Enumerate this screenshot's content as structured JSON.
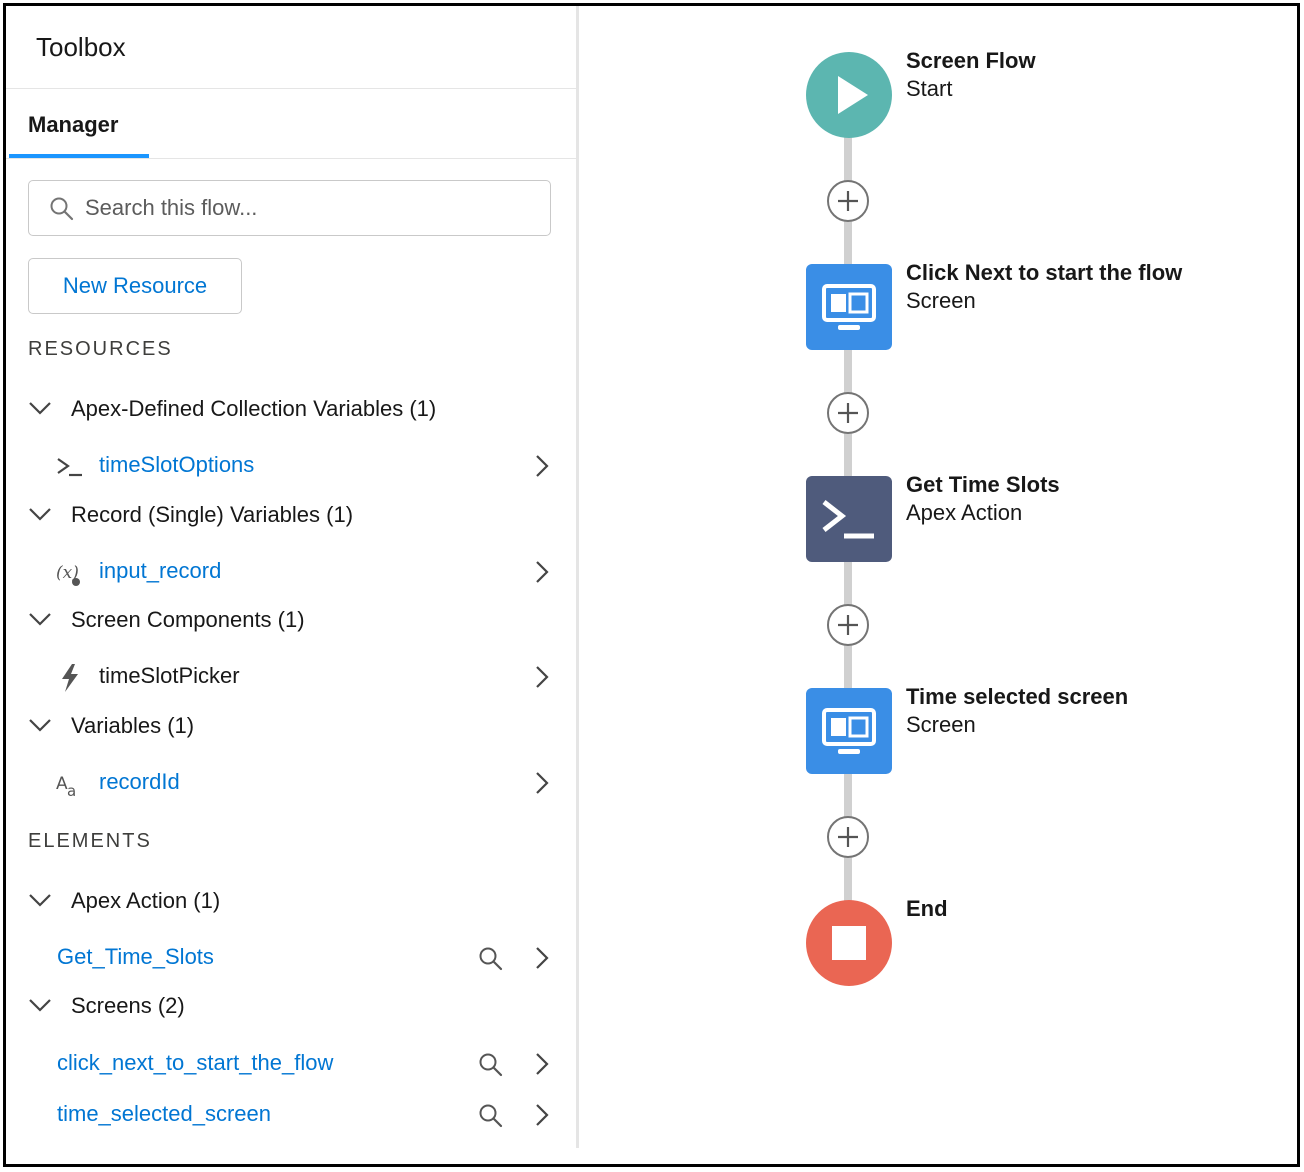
{
  "toolbox": {
    "title": "Toolbox",
    "tab": "Manager",
    "search_placeholder": "Search this flow...",
    "new_resource_label": "New Resource",
    "resources_label": "RESOURCES",
    "elements_label": "ELEMENTS",
    "resource_groups": [
      {
        "label": "Apex-Defined Collection Variables (1)",
        "items": [
          {
            "label": "timeSlotOptions",
            "icon": "apex-terminal-icon"
          }
        ]
      },
      {
        "label": "Record (Single) Variables (1)",
        "items": [
          {
            "label": "input_record",
            "icon": "record-variable-icon"
          }
        ]
      },
      {
        "label": "Screen Components (1)",
        "items": [
          {
            "label": "timeSlotPicker",
            "icon": "lightning-bolt-icon"
          }
        ]
      },
      {
        "label": "Variables (1)",
        "items": [
          {
            "label": "recordId",
            "icon": "text-variable-icon"
          }
        ]
      }
    ],
    "element_groups": [
      {
        "label": "Apex Action (1)",
        "items": [
          {
            "label": "Get_Time_Slots"
          }
        ]
      },
      {
        "label": "Screens (2)",
        "items": [
          {
            "label": "click_next_to_start_the_flow"
          },
          {
            "label": "time_selected_screen"
          }
        ]
      }
    ]
  },
  "canvas": {
    "nodes": [
      {
        "title": "Screen Flow",
        "subtitle": "Start",
        "color": "#5cb6b0",
        "icon": "play-icon"
      },
      {
        "title": "Click Next to start the flow",
        "subtitle": "Screen",
        "color": "#3a8ee6",
        "icon": "screen-icon"
      },
      {
        "title": "Get Time Slots",
        "subtitle": "Apex Action",
        "color": "#4f5b7c",
        "icon": "apex-terminal-icon"
      },
      {
        "title": "Time selected screen",
        "subtitle": "Screen",
        "color": "#3a8ee6",
        "icon": "screen-icon"
      },
      {
        "title": "End",
        "subtitle": "",
        "color": "#ea6653",
        "icon": "stop-icon"
      }
    ]
  }
}
